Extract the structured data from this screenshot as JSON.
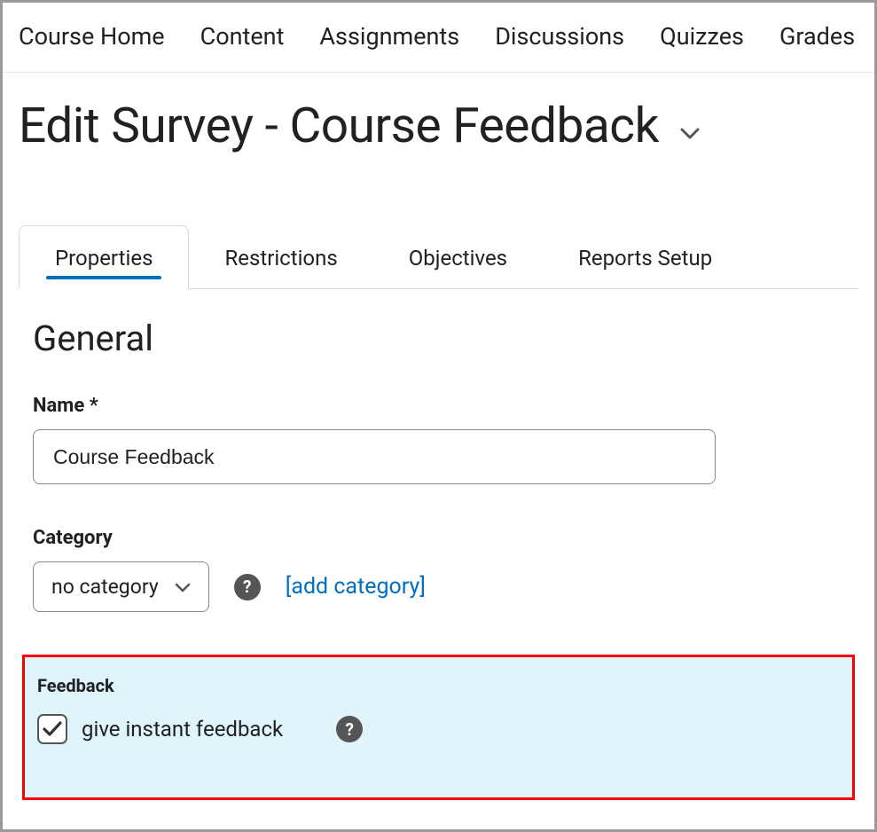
{
  "topnav": {
    "items": [
      {
        "label": "Course Home"
      },
      {
        "label": "Content"
      },
      {
        "label": "Assignments"
      },
      {
        "label": "Discussions"
      },
      {
        "label": "Quizzes"
      },
      {
        "label": "Grades"
      }
    ]
  },
  "page": {
    "title": "Edit Survey - Course Feedback"
  },
  "tabs": {
    "items": [
      {
        "label": "Properties",
        "active": true
      },
      {
        "label": "Restrictions",
        "active": false
      },
      {
        "label": "Objectives",
        "active": false
      },
      {
        "label": "Reports Setup",
        "active": false
      }
    ]
  },
  "general": {
    "heading": "General",
    "name_label": "Name *",
    "name_value": "Course Feedback",
    "category_label": "Category",
    "category_selected": "no category",
    "add_category_link": "[add category]"
  },
  "feedback": {
    "heading": "Feedback",
    "checkbox_label": "give instant feedback",
    "checked": true
  },
  "icons": {
    "help": "?"
  }
}
